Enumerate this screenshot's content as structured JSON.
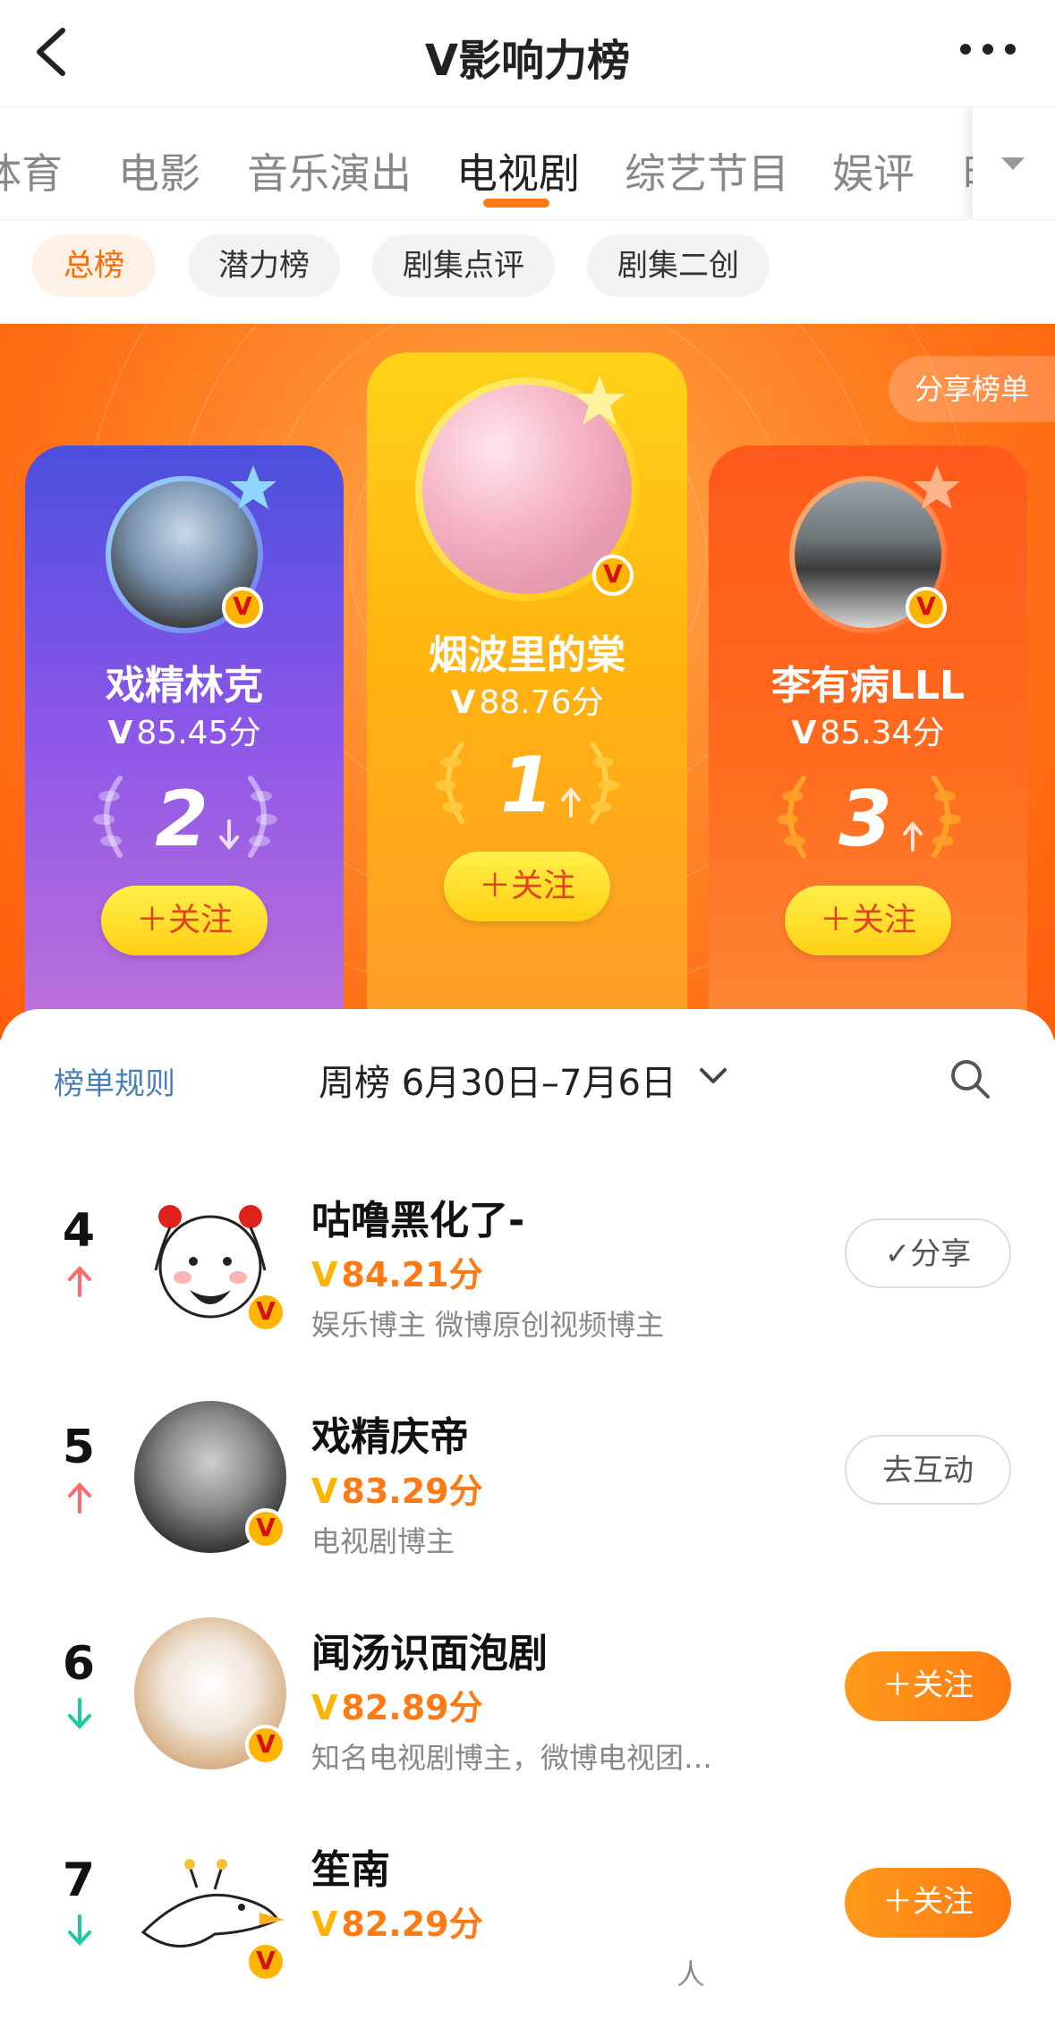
{
  "header": {
    "title": "V影响力榜"
  },
  "tabs": [
    {
      "label": "体育"
    },
    {
      "label": "电影"
    },
    {
      "label": "音乐演出"
    },
    {
      "label": "电视剧"
    },
    {
      "label": "综艺节目"
    },
    {
      "label": "娱评"
    },
    {
      "label": "时"
    }
  ],
  "active_tab": "电视剧",
  "chips": [
    {
      "label": "总榜"
    },
    {
      "label": "潜力榜"
    },
    {
      "label": "剧集点评"
    },
    {
      "label": "剧集二创"
    }
  ],
  "banner": {
    "share_label": "分享榜单",
    "podium": [
      {
        "rank": "2",
        "name": "戏精林克",
        "score_prefix": "V",
        "score": "85.45分",
        "trend": "down",
        "follow": "＋关注",
        "verify": "V"
      },
      {
        "rank": "1",
        "name": "烟波里的棠",
        "score_prefix": "V",
        "score": "88.76分",
        "trend": "up",
        "follow": "＋关注",
        "verify": "V"
      },
      {
        "rank": "3",
        "name": "李有病LLL",
        "score_prefix": "V",
        "score": "85.34分",
        "trend": "up",
        "follow": "＋关注",
        "verify": "V"
      }
    ]
  },
  "list_header": {
    "rules_label": "榜单规则",
    "period_label": "周榜  6月30日–7月6日"
  },
  "list": [
    {
      "rank": "4",
      "trend": "up",
      "name": "咕噜黑化了-",
      "score_prefix": "V",
      "score": "84.21分",
      "desc": "娱乐博主 微博原创视频博主",
      "button": "✓分享",
      "button_style": "outline",
      "verify": "V"
    },
    {
      "rank": "5",
      "trend": "up",
      "name": "戏精庆帝",
      "score_prefix": "V",
      "score": "83.29分",
      "desc": "电视剧博主",
      "button": "去互动",
      "button_style": "outline",
      "verify": "V"
    },
    {
      "rank": "6",
      "trend": "down",
      "name": "闻汤识面泡剧",
      "score_prefix": "V",
      "score": "82.89分",
      "desc": "知名电视剧博主，微博电视团…",
      "button": "＋关注",
      "button_style": "orange",
      "verify": "V"
    },
    {
      "rank": "7",
      "trend": "down",
      "name": "笙南",
      "score_prefix": "V",
      "score": "82.29分",
      "desc": "人",
      "button": "＋关注",
      "button_style": "orange",
      "verify": "V"
    }
  ],
  "colors": {
    "accent": "#ff7a12",
    "trend_up": "#ff6b6b",
    "trend_down": "#1ec8a0",
    "link": "#4a7fb8"
  }
}
